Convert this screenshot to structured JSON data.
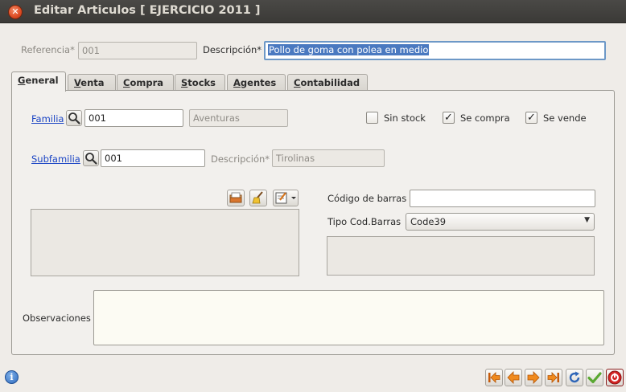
{
  "window": {
    "title": "Editar Articulos [ EJERCICIO 2011 ]"
  },
  "header": {
    "referencia_label": "Referencia*",
    "referencia_value": "001",
    "descripcion_label": "Descripción*",
    "descripcion_value": "Pollo de goma con polea en medio"
  },
  "tabs": [
    {
      "hot": "G",
      "rest": "eneral"
    },
    {
      "hot": "V",
      "rest": "enta"
    },
    {
      "hot": "C",
      "rest": "ompra"
    },
    {
      "hot": "S",
      "rest": "tocks"
    },
    {
      "hot": "A",
      "rest": "gentes"
    },
    {
      "hot": "C",
      "rest": "ontabilidad"
    }
  ],
  "general": {
    "familia_link": "Familia",
    "familia_code": "001",
    "familia_name": "Aventuras",
    "subfamilia_link": "Subfamilia",
    "subfamilia_code": "001",
    "subdesc_label": "Descripción*",
    "subdesc_value": "Tirolinas",
    "sin_stock": "Sin stock",
    "sin_stock_checked": false,
    "se_compra": "Se compra",
    "se_compra_checked": true,
    "se_vende": "Se vende",
    "se_vende_checked": true,
    "codigo_barras_label": "Código de barras",
    "codigo_barras_value": "",
    "tipo_codbarras_label": "Tipo Cod.Barras",
    "tipo_codbarras_value": "Code39",
    "observaciones_label": "Observaciones",
    "observaciones_value": "",
    "check_mark": "✓"
  },
  "colors": {
    "accent": "#4a79c0",
    "close": "#dc4a22",
    "nav_orange": "#f08a1e"
  }
}
